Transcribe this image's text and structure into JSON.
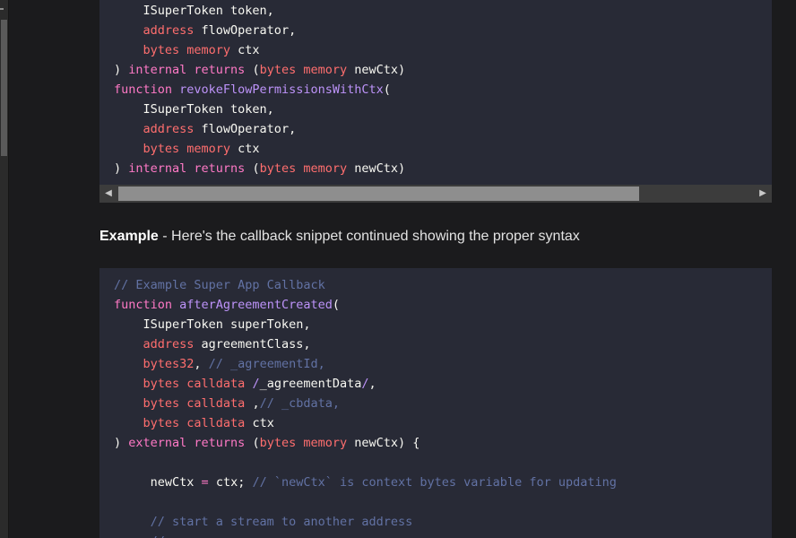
{
  "code_block_1": {
    "lines": [
      [
        {
          "c": "pl",
          "t": "    ISuperToken token,"
        }
      ],
      [
        {
          "c": "ty",
          "t": "    address"
        },
        {
          "c": "pl",
          "t": " flowOperator,"
        }
      ],
      [
        {
          "c": "ty",
          "t": "    bytes memory"
        },
        {
          "c": "pl",
          "t": " ctx"
        }
      ],
      [
        {
          "c": "pl",
          "t": ") "
        },
        {
          "c": "kw",
          "t": "internal returns"
        },
        {
          "c": "pl",
          "t": " ("
        },
        {
          "c": "ty",
          "t": "bytes memory"
        },
        {
          "c": "pl",
          "t": " newCtx)"
        }
      ],
      [
        {
          "c": "kw",
          "t": "function "
        },
        {
          "c": "fn",
          "t": "revokeFlowPermissionsWithCtx"
        },
        {
          "c": "pl",
          "t": "("
        }
      ],
      [
        {
          "c": "pl",
          "t": "    ISuperToken token,"
        }
      ],
      [
        {
          "c": "ty",
          "t": "    address"
        },
        {
          "c": "pl",
          "t": " flowOperator,"
        }
      ],
      [
        {
          "c": "ty",
          "t": "    bytes memory"
        },
        {
          "c": "pl",
          "t": " ctx"
        }
      ],
      [
        {
          "c": "pl",
          "t": ") "
        },
        {
          "c": "kw",
          "t": "internal returns"
        },
        {
          "c": "pl",
          "t": " ("
        },
        {
          "c": "ty",
          "t": "bytes memory"
        },
        {
          "c": "pl",
          "t": " newCtx)"
        }
      ]
    ]
  },
  "example": {
    "label": "Example",
    "text": " - Here's the callback snippet continued showing the proper syntax"
  },
  "code_block_2": {
    "lines": [
      [
        {
          "c": "cm",
          "t": "// Example Super App Callback"
        }
      ],
      [
        {
          "c": "kw",
          "t": "function "
        },
        {
          "c": "fn",
          "t": "afterAgreementCreated"
        },
        {
          "c": "pl",
          "t": "("
        }
      ],
      [
        {
          "c": "pl",
          "t": "    ISuperToken superToken,"
        }
      ],
      [
        {
          "c": "ty",
          "t": "    address"
        },
        {
          "c": "pl",
          "t": " agreementClass,"
        }
      ],
      [
        {
          "c": "ty",
          "t": "    bytes32"
        },
        {
          "c": "pl",
          "t": ", "
        },
        {
          "c": "cm",
          "t": "// _agreementId,"
        }
      ],
      [
        {
          "c": "ty",
          "t": "    bytes calldata"
        },
        {
          "c": "pl",
          "t": " "
        },
        {
          "c": "fn",
          "t": "/"
        },
        {
          "c": "pl",
          "t": "_agreementData"
        },
        {
          "c": "fn",
          "t": "/"
        },
        {
          "c": "pl",
          "t": ","
        }
      ],
      [
        {
          "c": "ty",
          "t": "    bytes calldata"
        },
        {
          "c": "pl",
          "t": " ,"
        },
        {
          "c": "cm",
          "t": "// _cbdata,"
        }
      ],
      [
        {
          "c": "ty",
          "t": "    bytes calldata"
        },
        {
          "c": "pl",
          "t": " ctx"
        }
      ],
      [
        {
          "c": "pl",
          "t": ") "
        },
        {
          "c": "kw",
          "t": "external returns"
        },
        {
          "c": "pl",
          "t": " ("
        },
        {
          "c": "ty",
          "t": "bytes memory"
        },
        {
          "c": "pl",
          "t": " newCtx) {"
        }
      ],
      [
        {
          "c": "pl",
          "t": ""
        }
      ],
      [
        {
          "c": "pl",
          "t": "     newCtx "
        },
        {
          "c": "kw",
          "t": "="
        },
        {
          "c": "pl",
          "t": " ctx; "
        },
        {
          "c": "cm",
          "t": "// `newCtx` is context bytes variable for updating"
        }
      ],
      [
        {
          "c": "pl",
          "t": ""
        }
      ],
      [
        {
          "c": "cm",
          "t": "     // start a stream to another address"
        }
      ],
      [
        {
          "c": "cm",
          "t": "     // ..."
        }
      ]
    ]
  },
  "scrollbar": {
    "left_arrow": "◀",
    "right_arrow": "▶",
    "thumb_fraction": 0.82
  },
  "colors": {
    "background": "#1b1b1d",
    "code_background": "#282a36",
    "keyword": "#ff79c6",
    "type": "#ff6e6e",
    "function_name": "#bd93f9",
    "comment": "#6272a4",
    "plain": "#f8f8f2"
  }
}
